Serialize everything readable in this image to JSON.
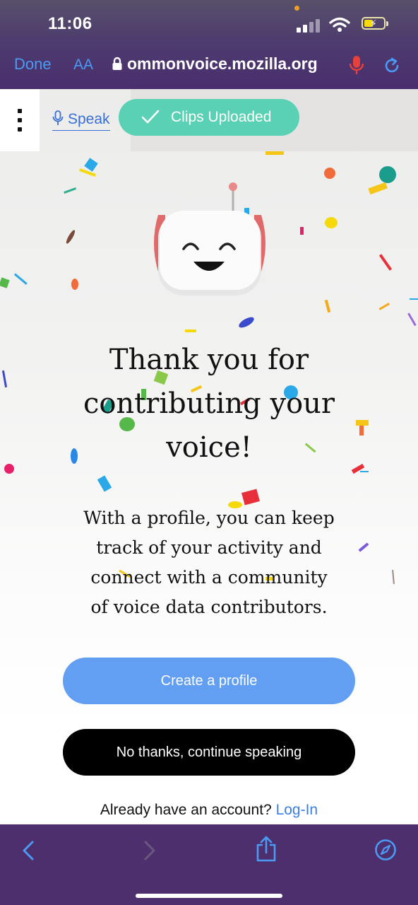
{
  "status_bar": {
    "time": "11:06",
    "battery_color": "#f5d90a"
  },
  "browser": {
    "done_label": "Done",
    "text_size_label": "AA",
    "url": "ommonvoice.mozilla.org",
    "icons": [
      "lock-icon",
      "microphone-icon",
      "reload-icon"
    ],
    "accent_color": "#4b9bf5"
  },
  "nav": {
    "menu_icon": "kebab-menu-icon",
    "speak_label": "Speak"
  },
  "toast": {
    "label": "Clips Uploaded",
    "color": "#5ad0b4",
    "icon": "check-icon"
  },
  "content": {
    "heading_line1": "Thank you for",
    "heading_line2": "contributing your",
    "heading_line3": "voice!",
    "body_line1": "With a profile, you can keep",
    "body_line2": "track of your activity and",
    "body_line3": "connect with a community",
    "body_line4": "of voice data contributors.",
    "create_profile_label": "Create a profile",
    "create_profile_color": "#629ff3",
    "no_thanks_label": "No thanks, continue speaking",
    "login_prompt": "Already have an account?",
    "login_link": "Log-In"
  },
  "toolbar": {
    "icons": [
      "back-icon",
      "forward-icon",
      "share-icon",
      "compass-icon"
    ],
    "background": "#4c2f6c"
  }
}
